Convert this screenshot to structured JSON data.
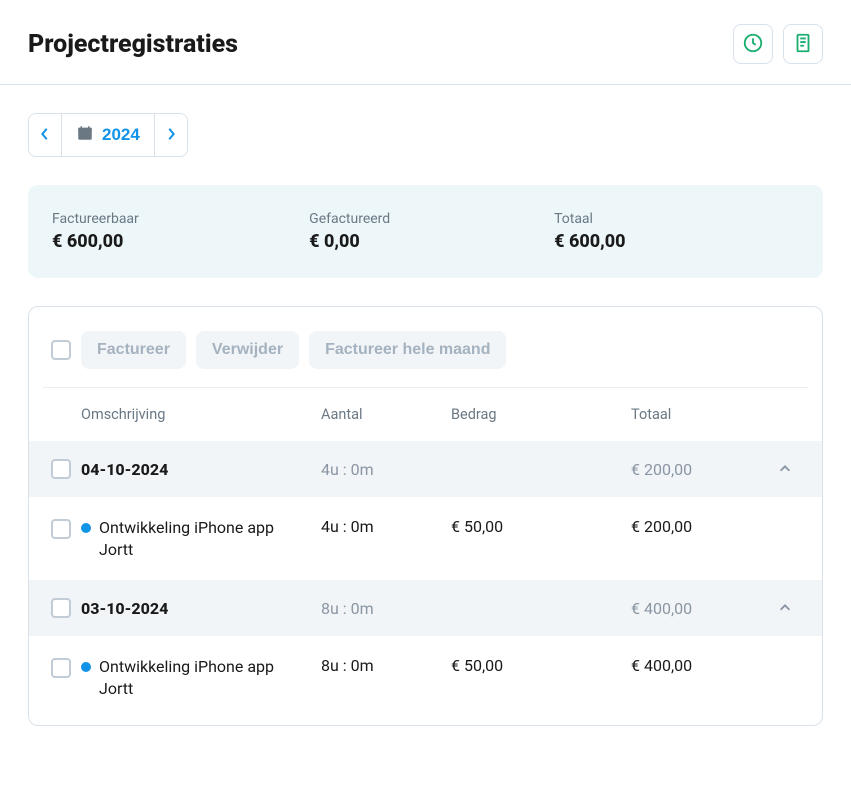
{
  "header": {
    "title": "Projectregistraties"
  },
  "yearNav": {
    "year": "2024"
  },
  "summary": {
    "factureerbaar": {
      "label": "Factureerbaar",
      "value": "€ 600,00"
    },
    "gefactureerd": {
      "label": "Gefactureerd",
      "value": "€ 0,00"
    },
    "totaal": {
      "label": "Totaal",
      "value": "€ 600,00"
    }
  },
  "actions": {
    "factureer": "Factureer",
    "verwijder": "Verwijder",
    "factureerHeleMaand": "Factureer hele maand"
  },
  "columns": {
    "omschrijving": "Omschrijving",
    "aantal": "Aantal",
    "bedrag": "Bedrag",
    "totaal": "Totaal"
  },
  "groups": [
    {
      "date": "04-10-2024",
      "aantal": "4u : 0m",
      "totaal": "€ 200,00",
      "entries": [
        {
          "omschrijving": "Ontwikkeling iPhone app Jortt",
          "aantal": "4u : 0m",
          "bedrag": "€ 50,00",
          "totaal": "€ 200,00"
        }
      ]
    },
    {
      "date": "03-10-2024",
      "aantal": "8u : 0m",
      "totaal": "€ 400,00",
      "entries": [
        {
          "omschrijving": "Ontwikkeling iPhone app Jortt",
          "aantal": "8u : 0m",
          "bedrag": "€ 50,00",
          "totaal": "€ 400,00"
        }
      ]
    }
  ]
}
